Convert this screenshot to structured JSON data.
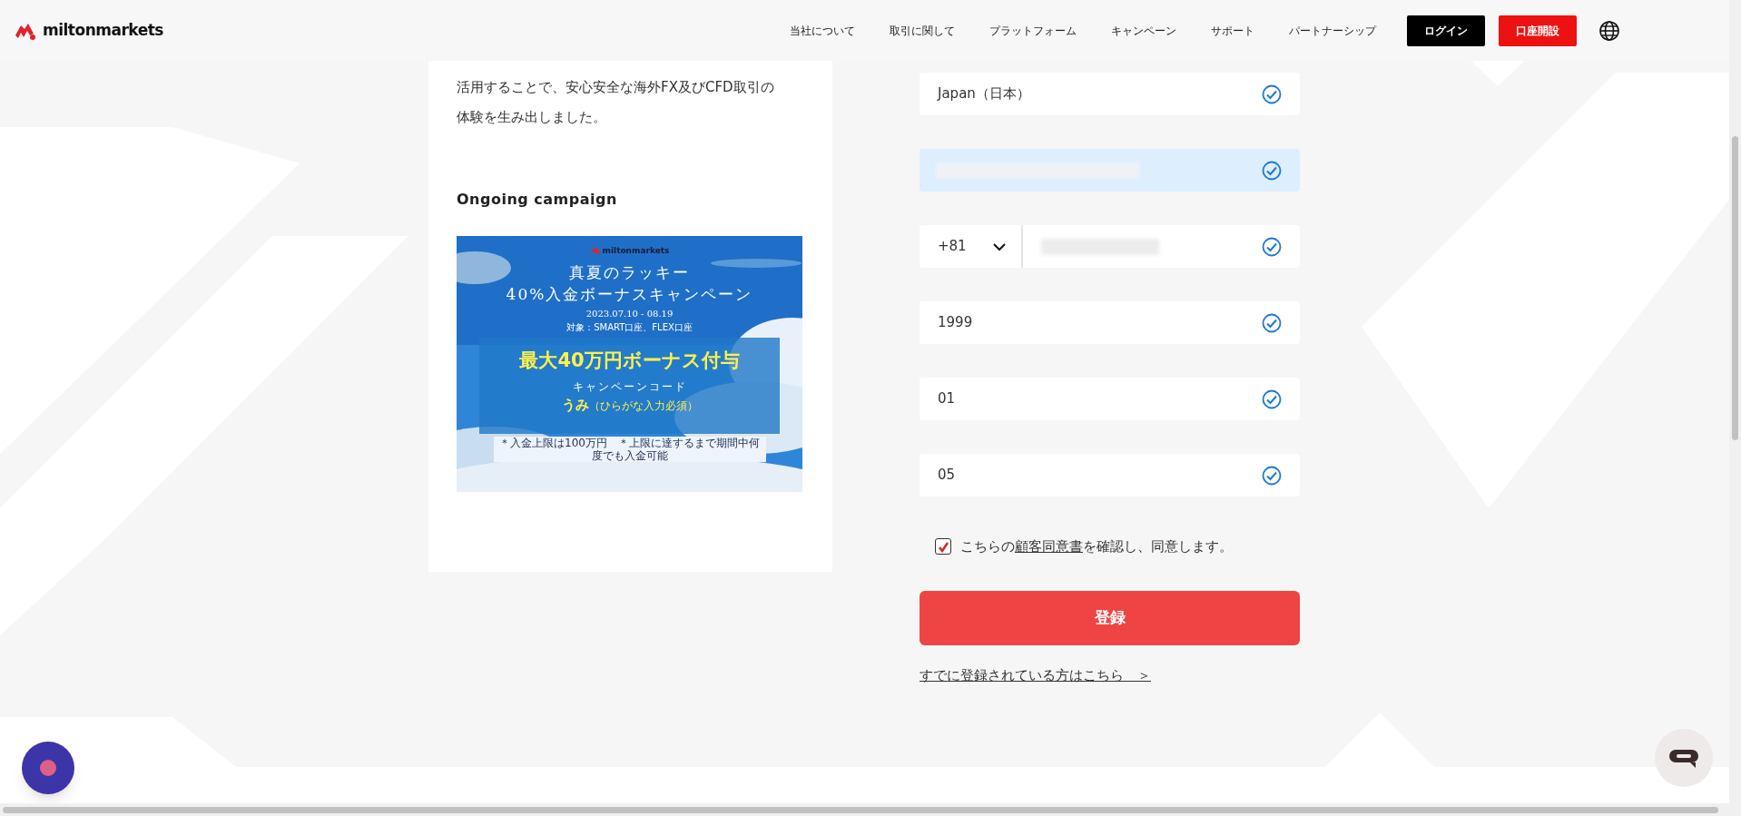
{
  "header": {
    "logo": "miltonmarkets",
    "nav": [
      "当社について",
      "取引に関して",
      "プラットフォーム",
      "キャンペーン",
      "サポート",
      "パートナーシップ"
    ],
    "login": "ログイン",
    "open_account": "口座開設"
  },
  "intro": {
    "lines": [
      "活用することで、安心安全な海外FX及びCFD取引の",
      "体験を生み出しました。"
    ],
    "campaign_heading": "Ongoing campaign"
  },
  "banner": {
    "logo": "miltonmarkets",
    "title_lines": [
      "真夏のラッキー",
      "40%入金ボーナスキャンペーン"
    ],
    "dates": "2023.07.10 - 08.19",
    "target": "対象：SMART口座、FLEX口座",
    "headline": "最大40万円ボーナス付与",
    "code_label": "キャンペーンコード",
    "code": "うみ",
    "code_note": "（ひらがな入力必須）",
    "footnote": "＊入金上限は100万円　＊上限に達するまで期間中何度でも入金可能"
  },
  "fields": [
    {
      "kind": "text",
      "value": "Japan（日本）",
      "highlighted": false,
      "valid": true
    },
    {
      "kind": "redacted",
      "highlighted": true,
      "valid": true
    },
    {
      "kind": "phone",
      "code": "+81",
      "highlighted": false,
      "valid": true
    },
    {
      "kind": "text",
      "value": "1999",
      "highlighted": false,
      "valid": true
    },
    {
      "kind": "text",
      "value": "01",
      "highlighted": false,
      "valid": true
    },
    {
      "kind": "text",
      "value": "05",
      "highlighted": false,
      "valid": true
    }
  ],
  "agreement": {
    "checked": true,
    "before": "こちらの",
    "link": "顧客同意書",
    "after": "を確認し、同意します。"
  },
  "submit": "登録",
  "login_link": "すでに登録されている方はこちら　＞"
}
